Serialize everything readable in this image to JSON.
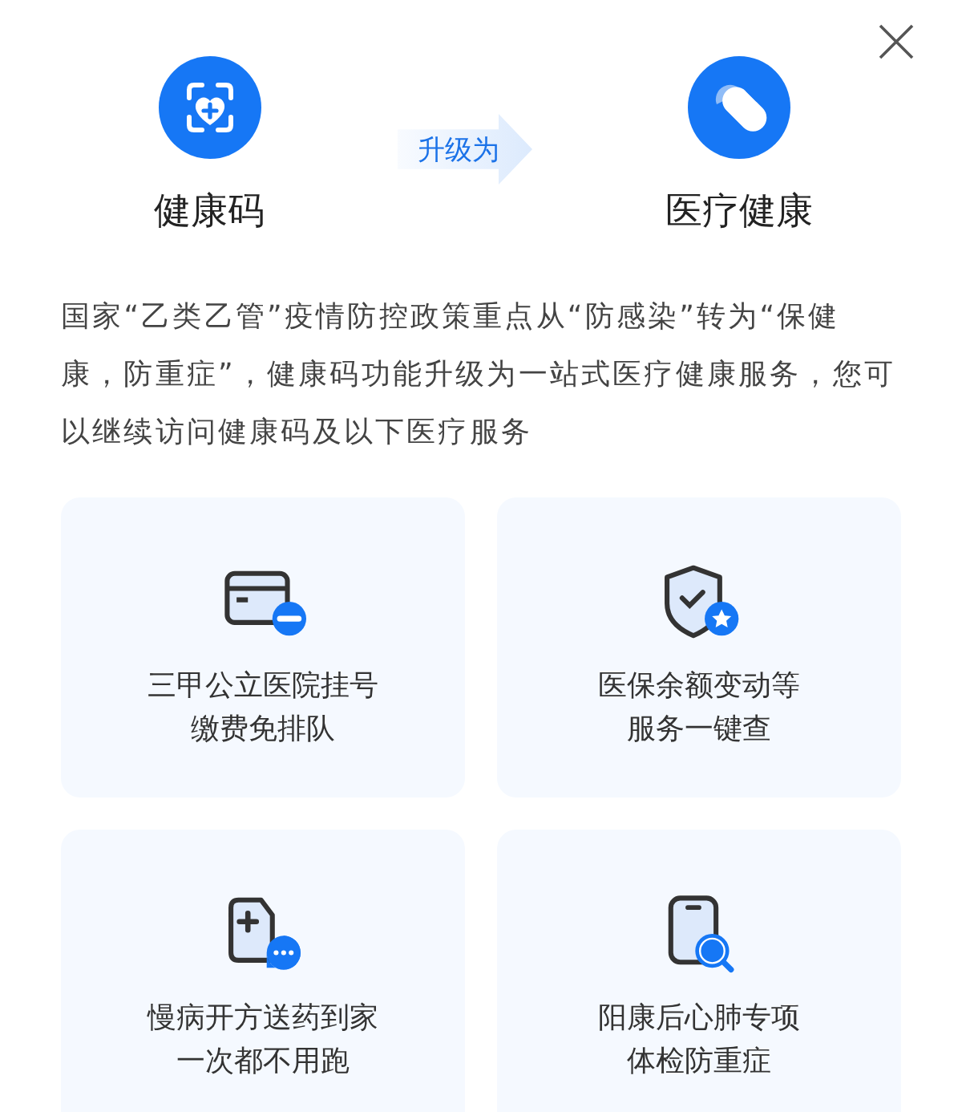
{
  "header": {
    "from_title": "健康码",
    "arrow_label": "升级为",
    "to_title": "医疗健康"
  },
  "description": "国家“乙类乙管”疫情防控政策重点从“防感染”转为“保健康，防重症”，健康码功能升级为一站式医疗健康服务，您可以继续访问健康码及以下医疗服务",
  "services": [
    {
      "lines": [
        "三甲公立医院挂号",
        "缴费免排队"
      ]
    },
    {
      "lines": [
        "医保余额变动等",
        "服务一键查"
      ]
    },
    {
      "lines": [
        "慢病开方送药到家",
        "一次都不用跑"
      ]
    },
    {
      "lines": [
        "阳康后心肺专项",
        "体检防重症"
      ]
    }
  ]
}
